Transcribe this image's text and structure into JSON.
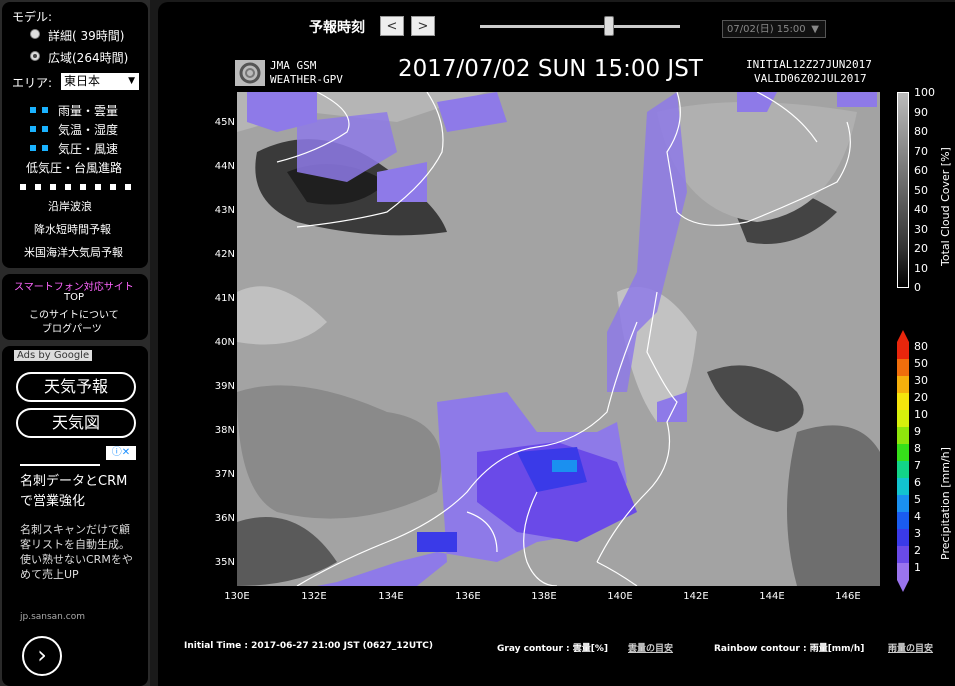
{
  "sidebar": {
    "model_label": "モデル:",
    "model_options": [
      {
        "label": "詳細(  39時間)",
        "selected": false
      },
      {
        "label": "広域(264時間)",
        "selected": true
      }
    ],
    "area_label": "エリア:",
    "area_value": "東日本",
    "layers": [
      "雨量・雲量",
      "気温・湿度",
      "気圧・風速"
    ],
    "menu1": "低気圧・台風進路",
    "menu2": [
      "沿岸波浪",
      "降水短時間予報",
      "米国海洋大気局予報"
    ],
    "links_title": "スマートフォン対応サイト",
    "links": [
      "TOP",
      "このサイトについて",
      "ブログパーツ"
    ],
    "ads_label": "Ads by Google",
    "ad_buttons": [
      "天気予報",
      "天気図"
    ],
    "ad_title": "名刺データとCRMで営業強化",
    "ad_body": "名刺スキャンだけで顧客リストを自動生成。使い熟せないCRMをやめて売上UP",
    "ad_url": "jp.sansan.com",
    "ad_next": "›"
  },
  "header": {
    "forecast_label": "予報時刻",
    "prev": "<",
    "next": ">",
    "date_select": "07/02(日) 15:00"
  },
  "chart": {
    "model_line1": "JMA GSM",
    "model_line2": "WEATHER-GPV",
    "title": "2017/07/02 SUN 15:00 JST",
    "initial": "INITIAL12Z27JUN2017",
    "valid": "VALID06Z02JUL2017",
    "lat_labels": [
      "45N",
      "44N",
      "43N",
      "42N",
      "41N",
      "40N",
      "39N",
      "38N",
      "37N",
      "36N",
      "35N"
    ],
    "lon_labels": [
      "130E",
      "132E",
      "134E",
      "136E",
      "138E",
      "140E",
      "142E",
      "144E",
      "146E"
    ],
    "cloud_labels": [
      "100",
      "90",
      "80",
      "70",
      "60",
      "50",
      "40",
      "30",
      "20",
      "10",
      "0"
    ],
    "cloud_title": "Total Cloud Cover [%]",
    "precip_labels": [
      "80",
      "50",
      "30",
      "20",
      "10",
      "9",
      "8",
      "7",
      "6",
      "5",
      "4",
      "3",
      "2",
      "1"
    ],
    "precip_title": "Precipitation [mm/h]",
    "precip_colors": [
      "#e8260c",
      "#f06e0c",
      "#f6b00c",
      "#f6e40c",
      "#d6f00c",
      "#8fe60c",
      "#36e01a",
      "#12d488",
      "#12c4d0",
      "#1a90f0",
      "#1a5cf0",
      "#3a3ae8",
      "#6a4ae8",
      "#9a74ee"
    ]
  },
  "footer": {
    "initial": "Initial Time : 2017-06-27 21:00 JST (0627_12UTC)",
    "gray": "Gray contour : 雲量[%]",
    "gray_link": "雲量の目安",
    "rainbow": "Rainbow contour : 雨量[mm/h]",
    "rainbow_link": "雨量の目安"
  }
}
